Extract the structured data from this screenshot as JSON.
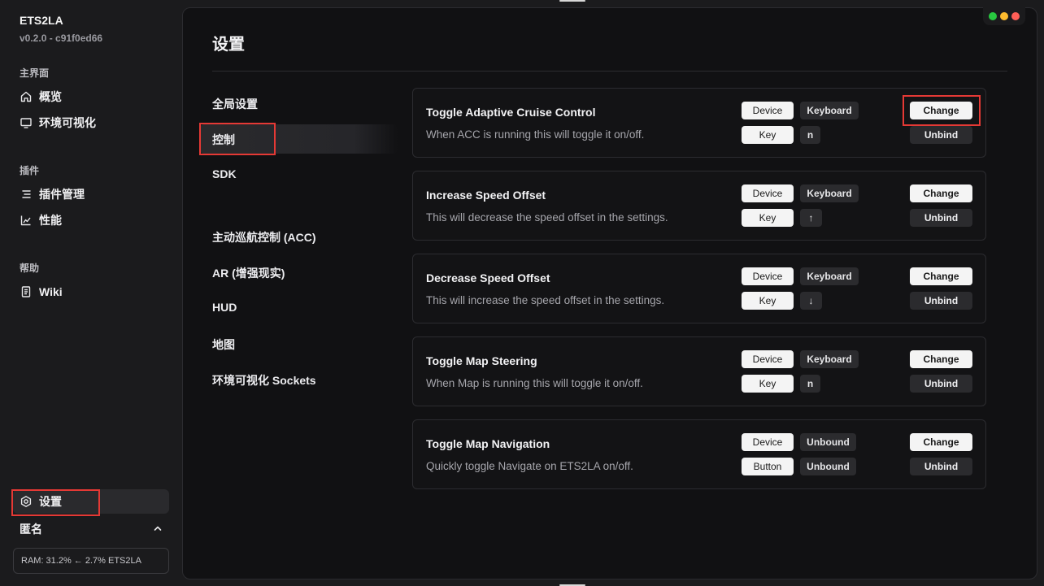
{
  "app": {
    "name": "ETS2LA",
    "version": "v0.2.0 - c91f0ed66"
  },
  "sidebar": {
    "groups": [
      {
        "title": "主界面",
        "items": [
          {
            "label": "概览",
            "icon": "home-icon"
          },
          {
            "label": "环境可视化",
            "icon": "monitor-icon"
          }
        ]
      },
      {
        "title": "插件",
        "items": [
          {
            "label": "插件管理",
            "icon": "list-icon"
          },
          {
            "label": "性能",
            "icon": "chart-icon"
          }
        ]
      },
      {
        "title": "帮助",
        "items": [
          {
            "label": "Wiki",
            "icon": "book-icon"
          }
        ]
      }
    ],
    "settings_label": "设置",
    "user_label": "匿名",
    "status": "RAM: 31.2% ← 2.7% ETS2LA"
  },
  "page": {
    "title": "设置",
    "subnav": [
      "全局设置",
      "控制",
      "SDK",
      "主动巡航控制 (ACC)",
      "AR (增强现实)",
      "HUD",
      "地图",
      "环境可视化 Sockets"
    ],
    "active_subnav": "控制"
  },
  "controls": [
    {
      "title": "Toggle Adaptive Cruise Control",
      "description": "When ACC is running this will toggle it on/off.",
      "device_label": "Device",
      "device_value": "Keyboard",
      "key_label": "Key",
      "key_value": "n",
      "change_label": "Change",
      "unbind_label": "Unbind"
    },
    {
      "title": "Increase Speed Offset",
      "description": "This will decrease the speed offset in the settings.",
      "device_label": "Device",
      "device_value": "Keyboard",
      "key_label": "Key",
      "key_value": "↑",
      "change_label": "Change",
      "unbind_label": "Unbind"
    },
    {
      "title": "Decrease Speed Offset",
      "description": "This will increase the speed offset in the settings.",
      "device_label": "Device",
      "device_value": "Keyboard",
      "key_label": "Key",
      "key_value": "↓",
      "change_label": "Change",
      "unbind_label": "Unbind"
    },
    {
      "title": "Toggle Map Steering",
      "description": "When Map is running this will toggle it on/off.",
      "device_label": "Device",
      "device_value": "Keyboard",
      "key_label": "Key",
      "key_value": "n",
      "change_label": "Change",
      "unbind_label": "Unbind"
    },
    {
      "title": "Toggle Map Navigation",
      "description": "Quickly toggle Navigate on ETS2LA on/off.",
      "device_label": "Device",
      "device_value": "Unbound",
      "key_label": "Button",
      "key_value": "Unbound",
      "change_label": "Change",
      "unbind_label": "Unbind"
    }
  ],
  "colors": {
    "accent_highlight": "#e53935",
    "traffic_red": "#ff5f57",
    "traffic_yellow": "#febc2e",
    "traffic_green": "#28c840"
  }
}
